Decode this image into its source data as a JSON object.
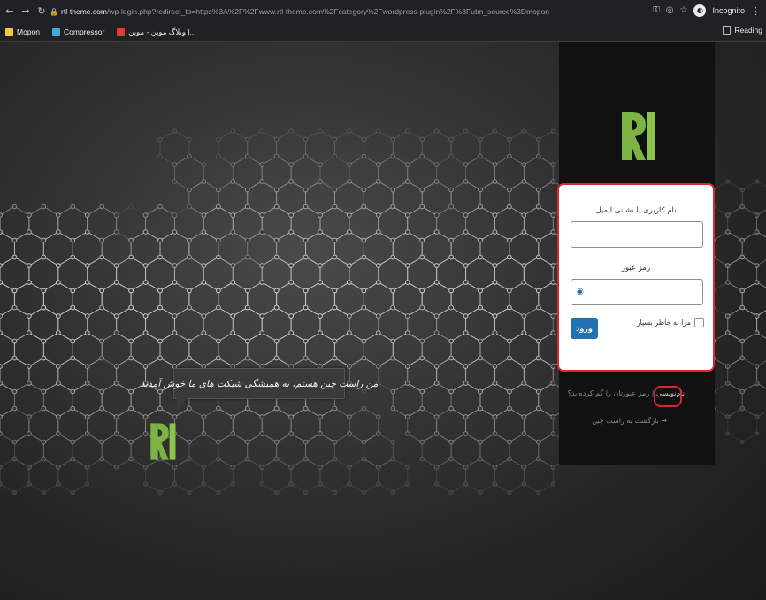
{
  "browser": {
    "url_host": "rtl-theme.com",
    "url_path": "/wp-login.php?redirect_to=https%3A%2F%2Fwww.rtl-theme.com%2Fcategory%2Fwordpress-plugin%2F%3Futm_source%3Dmopon",
    "profile_label": "Incognito",
    "icons": [
      "back-icon",
      "forward-icon",
      "reload-icon",
      "lock-icon",
      "key-icon",
      "eye-off-icon",
      "star-icon",
      "incognito-icon",
      "menu-icon"
    ]
  },
  "bookmarks": {
    "items": [
      {
        "label": "Mopon",
        "color": "#f6c445"
      },
      {
        "label": "Compressor",
        "color": "#4aa3df"
      },
      {
        "label": "وبلاگ موپن - موپن |...",
        "color": "#e53935"
      }
    ],
    "reading_label": "Reading"
  },
  "hero": {
    "bubble_text": "من راست چین هستم، به همیشگی شبکت های ما خوش آمدید"
  },
  "login": {
    "username_label": "نام کاربری یا نشانی ایمیل",
    "username_value": "",
    "password_label": "رمز عبور",
    "password_value": "",
    "remember_label": "مرا به خاطر بسپار",
    "remember_checked": false,
    "submit_label": "ورود"
  },
  "links": {
    "register": "نام‌نویسی",
    "separator": "|",
    "lost_password": "رمز عبورتان را گم کرده‌اید؟",
    "back": "→ بازگشت به راست چین"
  },
  "colors": {
    "accent": "#2271b1",
    "highlight": "#d9272e",
    "logo_green": "#7cb342",
    "panel": "#111111"
  }
}
